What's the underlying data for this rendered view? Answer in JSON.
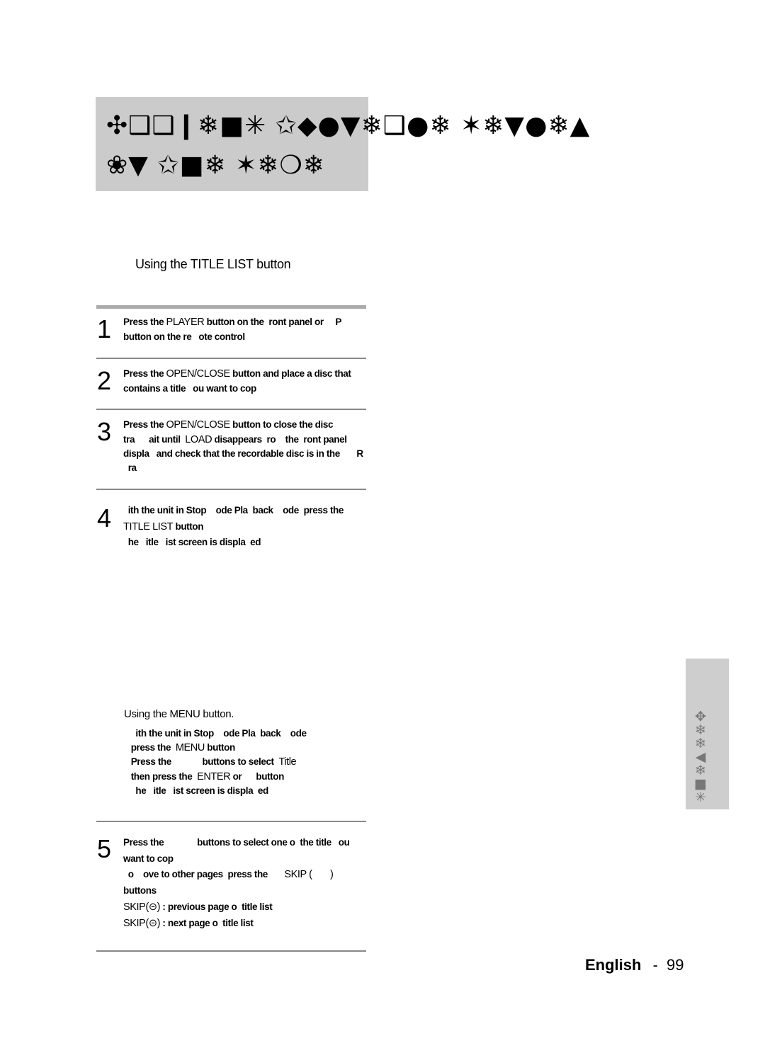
{
  "title": {
    "line1": "✣❑❑❙❄■✳ ✩◆●▼❄❑●❄ ✶❄▼●❄▲",
    "line2": "❀▼ ✩■❄ ✶❄❍❄"
  },
  "section1": {
    "heading": "Using the TITLE LIST button"
  },
  "steps": [
    {
      "number": "1",
      "lines": [
        "Press the |PLAYER| button on the  ront panel or     P",
        "button on the re   ote control"
      ]
    },
    {
      "number": "2",
      "lines": [
        "Press the |OPEN/CLOSE| button and place a disc that",
        "contains a title   ou want to cop"
      ]
    },
    {
      "number": "3",
      "lines": [
        "Press the |OPEN/CLOSE| button to close the disc",
        "tra      ait until  |LOAD| disappears  ro    the  ront panel",
        "displa   and check that the recordable disc is in the       R",
        "  ra"
      ]
    },
    {
      "number": "4",
      "lines": [
        "  ith the unit in Stop    ode Pla  back    ode  press the",
        "|TITLE LIST| button",
        "  he   itle   ist screen is displa  ed"
      ]
    },
    {
      "number": "5",
      "lines": [
        "Press the              buttons to select one o  the title   ou",
        "want to cop",
        "  o    ove to other pages  press the       |SKIP (       )|",
        "buttons",
        "|SKIP(⊝)| : previous page o  title list",
        "|SKIP(⊝)| : next page o  title list"
      ]
    }
  ],
  "section2": {
    "heading": "Using the MENU button.",
    "lines": [
      "    ith the unit in Stop    ode Pla  back    ode",
      "  press the  |MENU| button",
      "  Press the             buttons to select  |Title|",
      "  then press the  |ENTER| or      button",
      "    he   itle   ist screen is displa  ed"
    ]
  },
  "side_tab": {
    "label": "✥❄❄◀❄■✳"
  },
  "footer": {
    "language": "English",
    "separator": "-",
    "page_number": "99"
  }
}
